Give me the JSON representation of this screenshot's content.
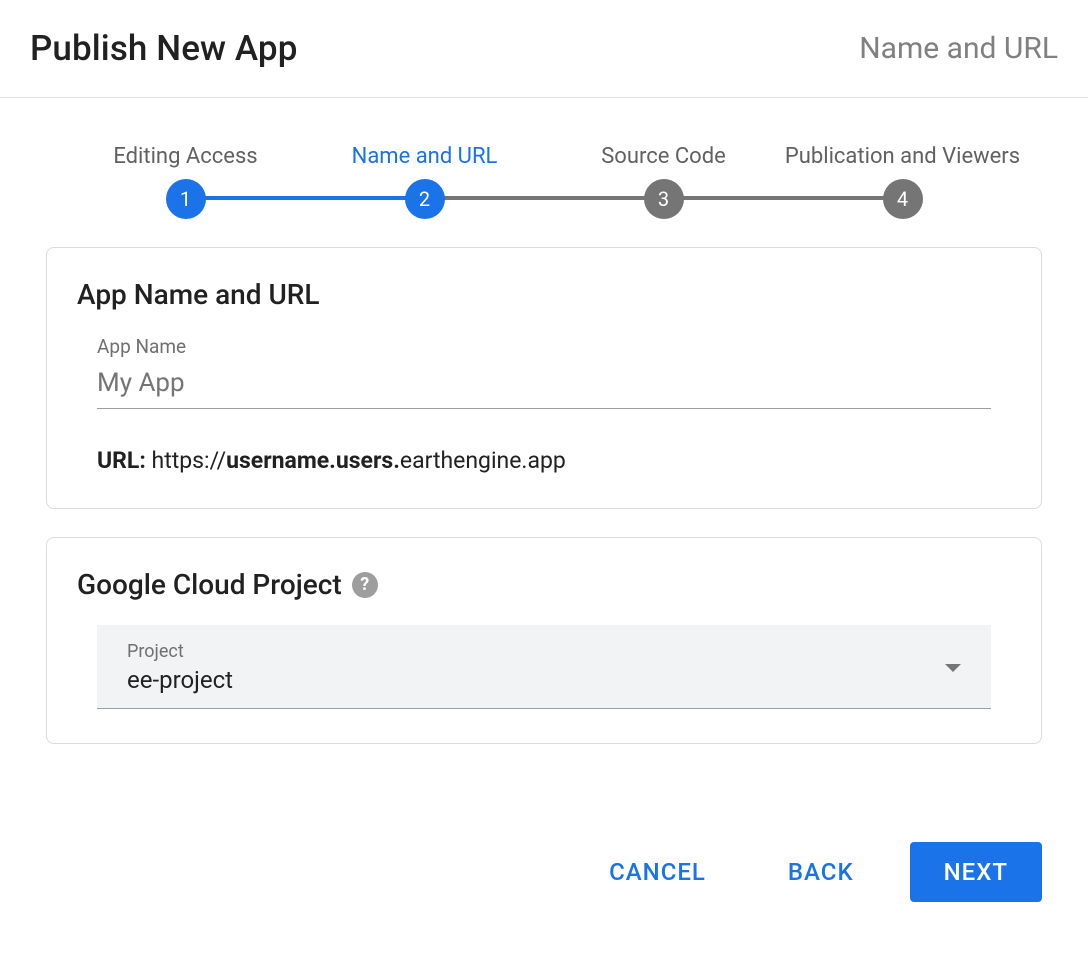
{
  "header": {
    "title": "Publish New App",
    "subtitle": "Name and URL"
  },
  "stepper": {
    "steps": [
      {
        "num": "1",
        "label": "Editing Access"
      },
      {
        "num": "2",
        "label": "Name and URL"
      },
      {
        "num": "3",
        "label": "Source Code"
      },
      {
        "num": "4",
        "label": "Publication and Viewers"
      }
    ]
  },
  "card_name_url": {
    "title": "App Name and URL",
    "app_name_label": "App Name",
    "app_name_placeholder": "My App",
    "url_label": "URL:",
    "url_prefix": "https://",
    "url_bold": "username.users.",
    "url_suffix": "earthengine.app"
  },
  "card_gcp": {
    "title": "Google Cloud Project",
    "select_label": "Project",
    "select_value": "ee-project"
  },
  "actions": {
    "cancel": "CANCEL",
    "back": "BACK",
    "next": "NEXT"
  }
}
